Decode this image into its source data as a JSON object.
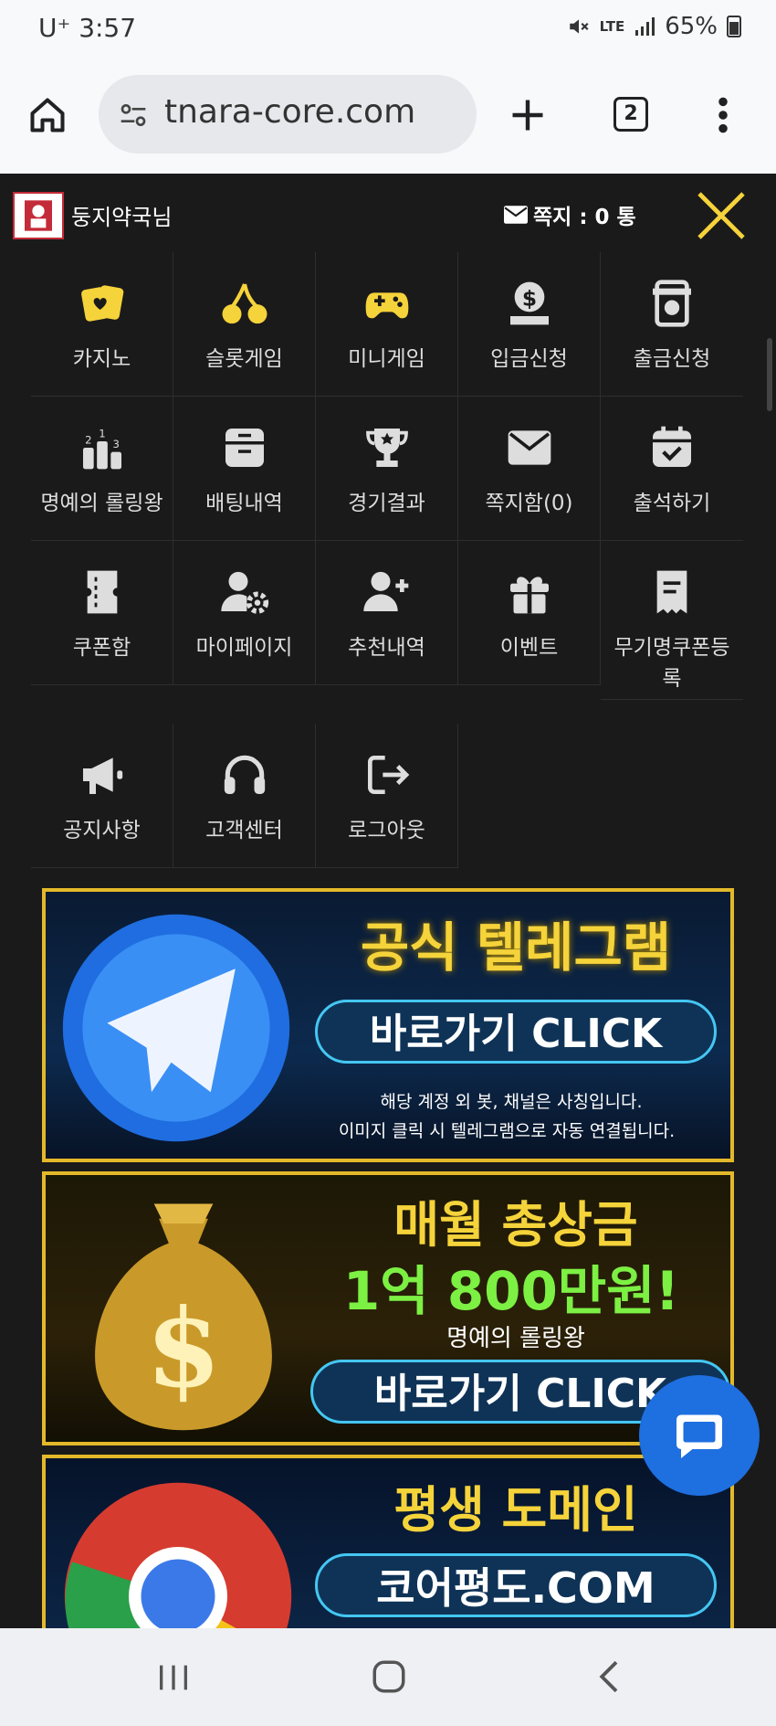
{
  "status": {
    "carrier": "U⁺",
    "time": "3:57",
    "network": "LTE",
    "battery": "65%"
  },
  "browser": {
    "url": "tnara-core.com",
    "tab_count": "2"
  },
  "user": {
    "name": "둥지약국님",
    "message_label": "쪽지 : 0 통"
  },
  "menu": [
    {
      "label": "카지노",
      "icon": "casino-cards-icon"
    },
    {
      "label": "슬롯게임",
      "icon": "cherry-icon"
    },
    {
      "label": "미니게임",
      "icon": "gamepad-icon"
    },
    {
      "label": "입금신청",
      "icon": "coin-deposit-icon"
    },
    {
      "label": "출금신청",
      "icon": "withdraw-icon"
    },
    {
      "label": "명예의 롤링왕",
      "icon": "ranking-podium-icon"
    },
    {
      "label": "배팅내역",
      "icon": "archive-box-icon"
    },
    {
      "label": "경기결과",
      "icon": "trophy-icon"
    },
    {
      "label": "쪽지함(0)",
      "icon": "envelope-icon"
    },
    {
      "label": "출석하기",
      "icon": "calendar-check-icon"
    },
    {
      "label": "쿠폰함",
      "icon": "coupon-icon"
    },
    {
      "label": "마이페이지",
      "icon": "user-gear-icon"
    },
    {
      "label": "추천내역",
      "icon": "user-plus-icon"
    },
    {
      "label": "이벤트",
      "icon": "gift-icon"
    },
    {
      "label": "무기명쿠폰등록",
      "icon": "receipt-icon"
    },
    {
      "label": "공지사항",
      "icon": "megaphone-icon"
    },
    {
      "label": "고객센터",
      "icon": "headset-icon"
    },
    {
      "label": "로그아웃",
      "icon": "logout-icon"
    }
  ],
  "banners": {
    "telegram": {
      "title": "공식 텔레그램",
      "button": "바로가기 CLICK",
      "note1": "해당 계정 외 봇, 채널은 사칭입니다.",
      "note2": "이미지 클릭 시 텔레그램으로 자동 연결됩니다."
    },
    "prize": {
      "title": "매월 총상금",
      "amount": "1억 800만원!",
      "sub": "명예의 롤링왕",
      "button": "바로가기 CLICK"
    },
    "domain": {
      "title": "평생 도메인",
      "domain": "코어평도.COM"
    }
  },
  "colors": {
    "accent": "#f5d33a",
    "panel_bg": "#1b1a1a",
    "banner_border": "#e3b92a",
    "fab": "#1e6fe0"
  }
}
